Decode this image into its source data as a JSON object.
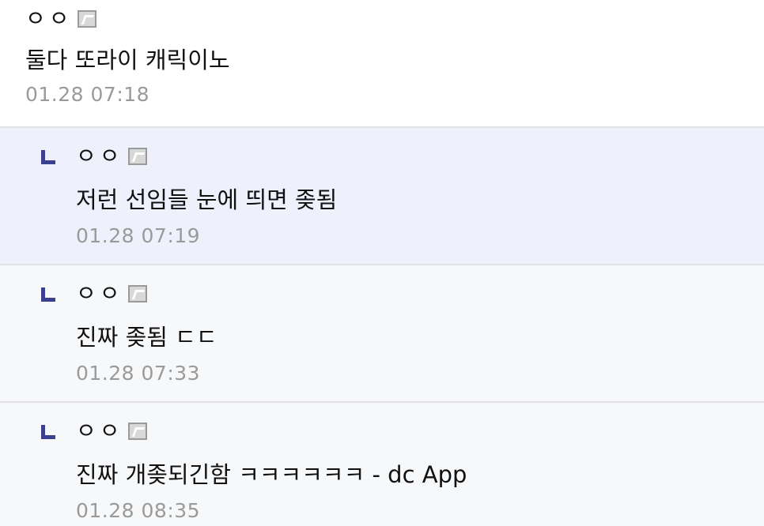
{
  "comments": [
    {
      "nickname": "ㅇㅇ",
      "icon": "fixed-nick-icon",
      "text": "둘다 또라이 캐릭이노",
      "date": "01.28 07:18"
    }
  ],
  "replies": [
    {
      "marker": "reply-arrow-icon",
      "nickname": "ㅇㅇ",
      "icon": "fixed-nick-icon",
      "text": "저런 선임들 눈에 띄면 좆됨",
      "date": "01.28 07:19",
      "highlighted": true
    },
    {
      "marker": "reply-arrow-icon",
      "nickname": "ㅇㅇ",
      "icon": "fixed-nick-icon",
      "text": "진짜 좆됨 ㄷㄷ",
      "date": "01.28 07:33"
    },
    {
      "marker": "reply-arrow-icon",
      "nickname": "ㅇㅇ",
      "icon": "fixed-nick-icon",
      "text": "진짜 개좆되긴함 ㅋㅋㅋㅋㅋㅋ - dc App",
      "date": "01.28 08:35"
    }
  ],
  "colors": {
    "highlight_bg": "#eef1fb",
    "reply_bg": "#f7f8fa",
    "reply_marker": "#3b3f8f",
    "date_text": "#9a9a9a",
    "divider": "#e2e2e6"
  }
}
